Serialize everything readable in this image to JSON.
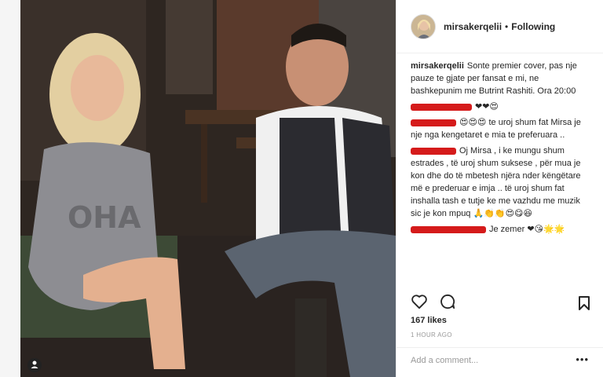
{
  "post": {
    "username": "mirsakerqelii",
    "follow_status": "Following",
    "separator": "•",
    "caption": "Sonte premier cover, pas nje pauze te gjate per fansat e mi, ne bashkepunim me Butrint Rashiti. Ora 20:00",
    "likes": "167 likes",
    "time": "1 HOUR AGO",
    "add_comment_placeholder": "Add a comment...",
    "more": "•••"
  },
  "comments": [
    {
      "user_redacted": true,
      "text": "",
      "emoji": "❤❤😍"
    },
    {
      "user_redacted": true,
      "text": "te uroj shum fat Mirsa je nje nga kengetaret e mia te preferuara ..",
      "emoji_prefix": "😍😍😍"
    },
    {
      "user_redacted": true,
      "text": "Oj Mirsa , i ke mungu shum estrades , të uroj shum suksese , për mua je kon dhe do të mbetesh njëra nder këngëtare më e prederuar e imja .. të uroj shum fat inshalla tash e tutje ke me vazhdu me muzik sic je kon mpuq",
      "emoji": "🙏👏👏😍😋😆"
    },
    {
      "user_redacted": true,
      "text": "Je zemer",
      "emoji": "❤😘🌟🌟"
    }
  ],
  "icons": {
    "like": "heart-icon",
    "comment": "comment-icon",
    "save": "bookmark-icon",
    "tag": "person-tag-icon"
  },
  "colors": {
    "redaction": "#d51b1b",
    "text": "#262626",
    "muted": "#999999"
  }
}
